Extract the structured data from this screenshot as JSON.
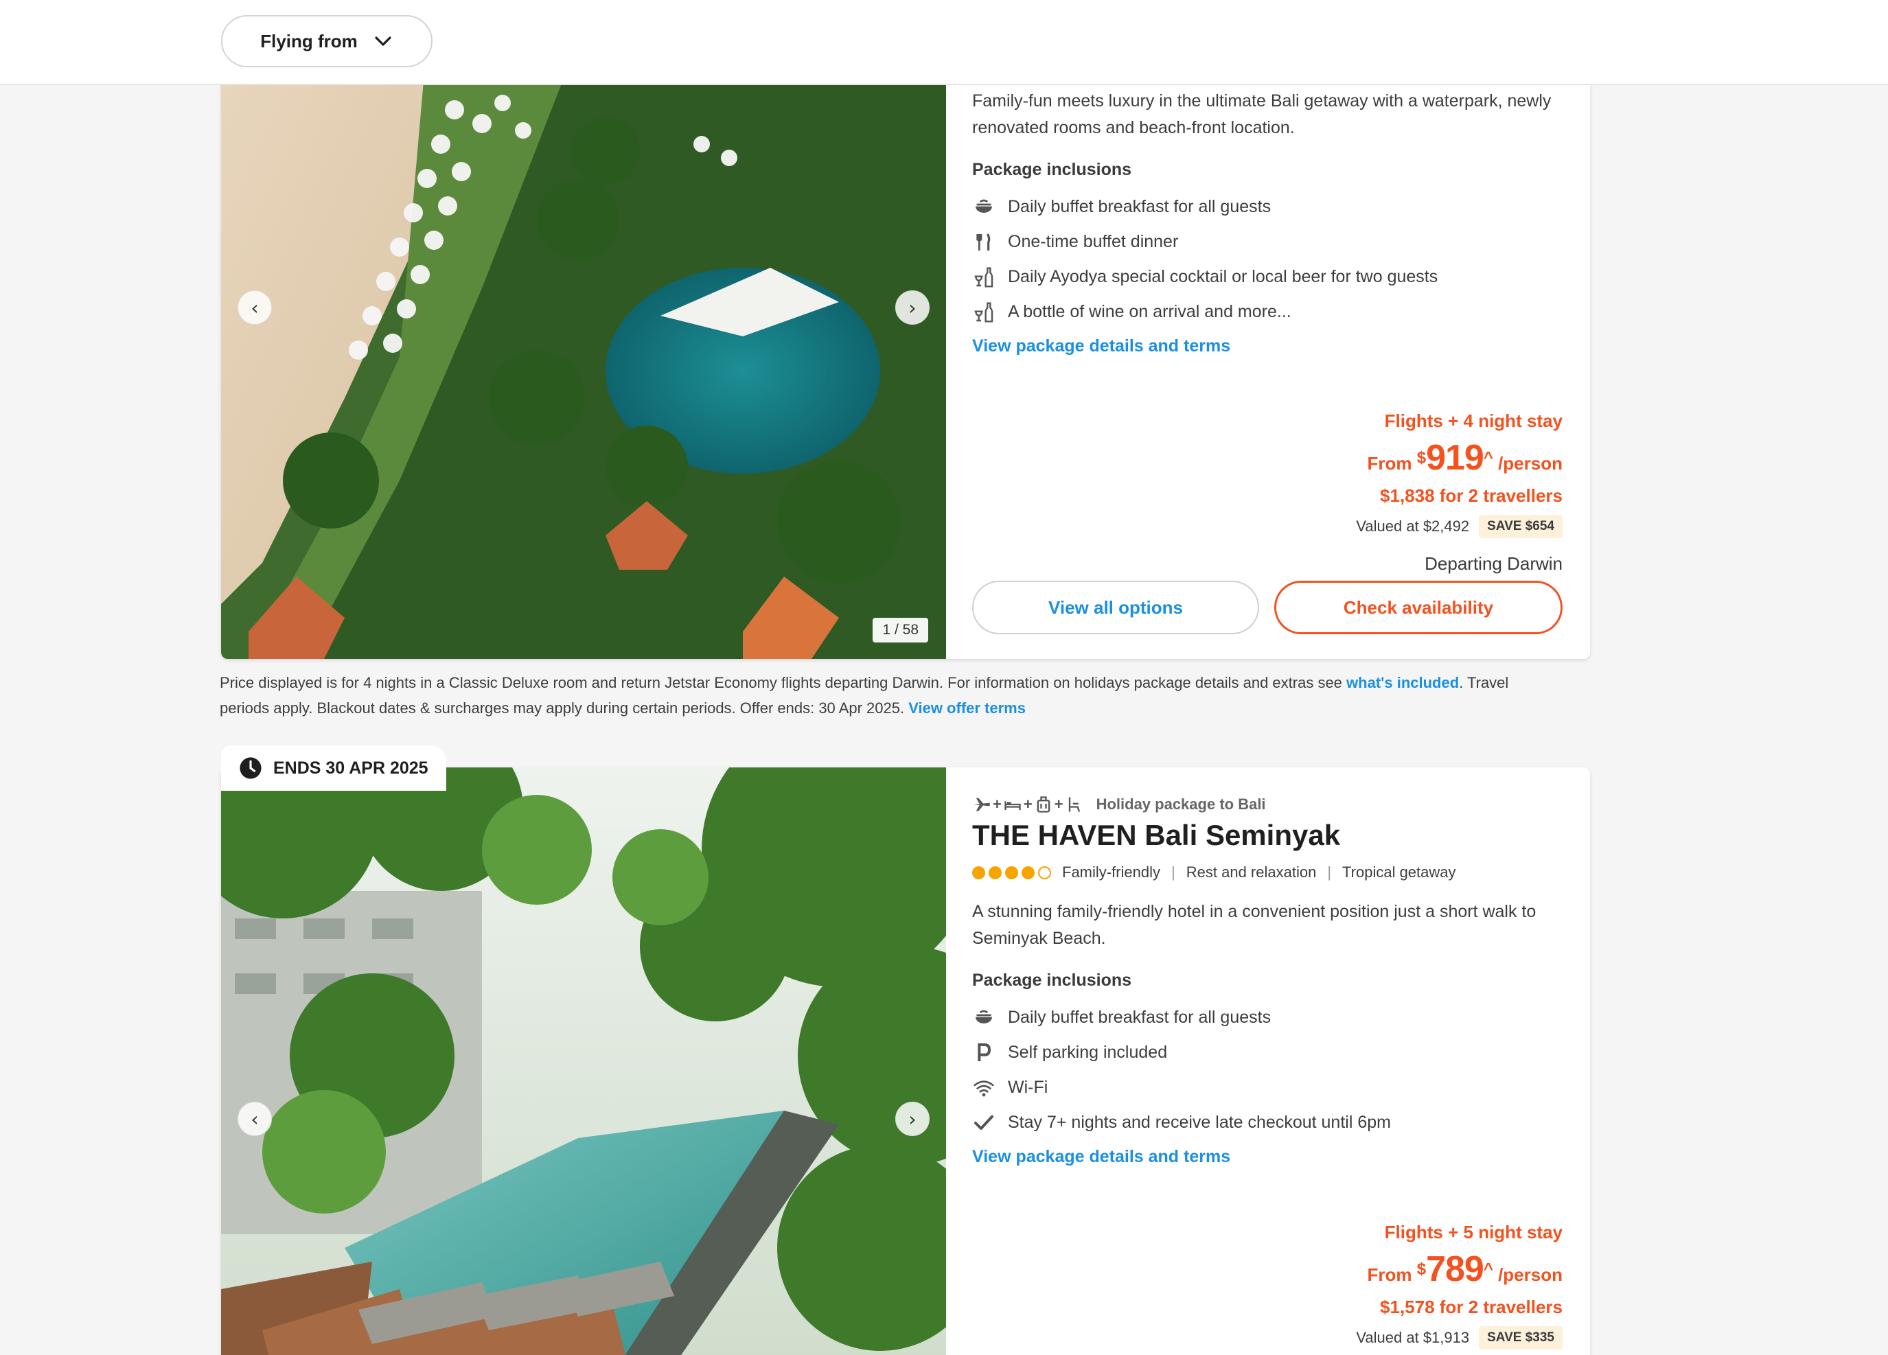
{
  "topbar": {
    "flying_from_label": "Flying from"
  },
  "card1": {
    "description": "Family-fun meets luxury in the ultimate Bali getaway with a waterpark, newly renovated rooms and beach-front location.",
    "inclusions_title": "Package inclusions",
    "inclusions": [
      {
        "icon": "breakfast-bowl-icon",
        "text": "Daily buffet breakfast for all guests"
      },
      {
        "icon": "cutlery-icon",
        "text": "One-time buffet dinner"
      },
      {
        "icon": "wine-bottle-icon",
        "text": "Daily Ayodya special cocktail or local beer for two guests"
      },
      {
        "icon": "wine-bottle-icon",
        "text": "A bottle of wine on arrival and more..."
      }
    ],
    "details_link": "View package details and terms",
    "photo_counter": "1 / 58",
    "price": {
      "stay": "Flights + 4 night stay",
      "from": "From",
      "currency": "$",
      "amount": "919",
      "caret": "^",
      "per": "/person",
      "total": "$1,838 for 2 travellers",
      "valued": "Valued at $2,492",
      "save": "SAVE $654",
      "departing": "Departing Darwin"
    },
    "view_all_label": "View all options",
    "check_label": "Check availability"
  },
  "disclaimer": {
    "text1": "Price displayed is for 4 nights in a Classic Deluxe room and return Jetstar Economy flights departing Darwin. For information on holidays package details and extras see ",
    "link1": "what's included",
    "text2": ". Travel periods apply. Blackout dates & surcharges may apply during certain periods. Offer ends: 30 Apr 2025. ",
    "link2": "View offer terms"
  },
  "card2": {
    "ends_label": "ENDS 30 APR 2025",
    "package_label": "Holiday package to Bali",
    "title": "THE HAVEN Bali Seminyak",
    "rating": 4,
    "rating_max": 5,
    "tags": [
      "Family-friendly",
      "Rest and relaxation",
      "Tropical getaway"
    ],
    "description": "A stunning family-friendly hotel in a convenient position just a short walk to Seminyak Beach.",
    "inclusions_title": "Package inclusions",
    "inclusions": [
      {
        "icon": "breakfast-bowl-icon",
        "text": "Daily buffet breakfast for all guests"
      },
      {
        "icon": "parking-icon",
        "text": "Self parking included"
      },
      {
        "icon": "wifi-icon",
        "text": "Wi-Fi"
      },
      {
        "icon": "checkmark-icon",
        "text": "Stay 7+ nights and receive late checkout until 6pm"
      }
    ],
    "details_link": "View package details and terms",
    "price": {
      "stay": "Flights + 5 night stay",
      "from": "From",
      "currency": "$",
      "amount": "789",
      "caret": "^",
      "per": "/person",
      "total": "$1,578 for 2 travellers",
      "valued": "Valued at $1,913",
      "save": "SAVE $335"
    }
  },
  "colors": {
    "accent_orange": "#f4511e",
    "link_blue": "#1a8fe3",
    "star": "#f7a300"
  }
}
